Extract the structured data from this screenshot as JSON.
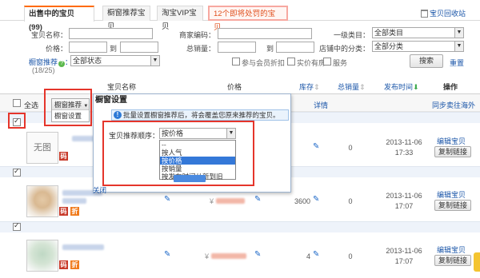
{
  "tabs": [
    {
      "label": "出售中的宝贝 (99)"
    },
    {
      "label": "橱窗推荐宝贝"
    },
    {
      "label": "淘宝VIP宝贝"
    },
    {
      "label": "12个即将处罚的宝贝"
    }
  ],
  "recycle_label": "宝贝回收站",
  "filters": {
    "name_label": "宝贝名称：",
    "merchant_code_label": "商家编码：",
    "category_label": "一级类目：",
    "category_value": "全部类目",
    "price_label": "价格：",
    "to_label": "到",
    "sales_label": "总销量：",
    "shop_category_label": "店铺中的分类：",
    "shop_category_value": "全部分类",
    "recommend_label": "橱窗推荐",
    "recommend_count": "(18/25)",
    "status_value": "全部状态",
    "checkbox_discount": "参与会员折扣",
    "checkbox_stock": "实价有房",
    "checkbox_service": "服务",
    "search_button": "搜索",
    "reset_link": "重置"
  },
  "table_header": {
    "name": "宝贝名称",
    "price": "价格",
    "stock": "库存",
    "sales": "总销量",
    "publish_time": "发布时间",
    "operation": "操作"
  },
  "toolbar": {
    "select_all": "全选",
    "recommend_button": "橱窗推荐",
    "details": "详情",
    "sync_sell": "同步卖往海外"
  },
  "menu": {
    "item1": "橱窗推荐",
    "item2": "橱窗设置"
  },
  "popup": {
    "title": "橱窗设置",
    "info": "批量设置橱窗推荐后，将会覆盖您原来推荐的宝贝。",
    "sort_label": "宝贝推荐顺序：",
    "sort_value": "按价格",
    "options": [
      "--",
      "按人气",
      "按价格",
      "按销量",
      "按发布时间从新到旧"
    ],
    "close_label": "关闭"
  },
  "rows": [
    {
      "image": "无图",
      "badge1": "码",
      "sales": "0",
      "date": "2013-11-06",
      "time": "17:33",
      "edit": "编辑宝贝",
      "copy": "复制链接"
    },
    {
      "badge1": "码",
      "badge2": "折",
      "stock": "3600",
      "sales": "0",
      "date": "2013-11-06",
      "time": "17:07",
      "edit": "编辑宝贝",
      "copy": "复制链接"
    },
    {
      "badge1": "码",
      "badge2": "折",
      "stock": "4",
      "sales": "0",
      "date": "2013-11-06",
      "time": "17:07",
      "edit": "编辑宝贝",
      "copy": "复制链接"
    }
  ],
  "colors": {
    "accent": "#ff6a00",
    "link": "#1a55a8",
    "highlight_border": "#e5352b"
  }
}
